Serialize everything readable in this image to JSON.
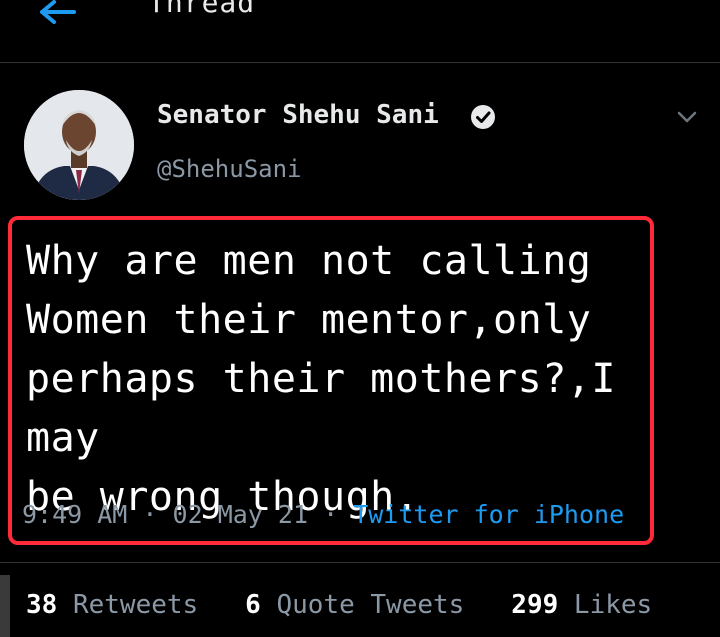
{
  "header": {
    "title": "Thread"
  },
  "tweet": {
    "display_name": "Senator Shehu Sani",
    "handle": "@ShehuSani",
    "text_lines": [
      "Why are men not calling",
      "Women their mentor,only",
      "perhaps their mothers?,I may",
      "be wrong though."
    ],
    "time": "9:49 AM",
    "date": "02 May 21",
    "source": "Twitter for iPhone",
    "separator": "·"
  },
  "stats": {
    "retweets_count": "38",
    "retweets_label": "Retweets",
    "quotes_count": "6",
    "quotes_label": "Quote Tweets",
    "likes_count": "299",
    "likes_label": "Likes"
  },
  "colors": {
    "background": "#000000",
    "accent": "#1d9bf0",
    "highlight": "#ff2a3a",
    "secondary_text": "#8b98a5"
  },
  "icons": [
    "back-arrow-icon",
    "verified-badge-icon",
    "chevron-down-icon"
  ]
}
